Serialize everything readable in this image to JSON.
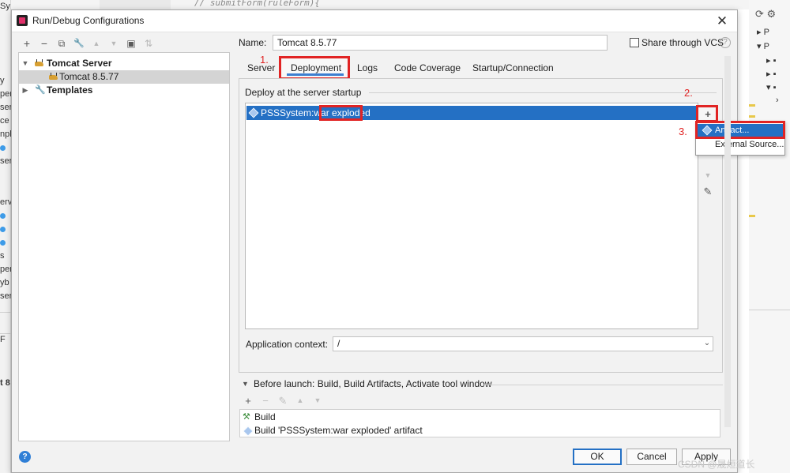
{
  "background": {
    "left_fragments": [
      "y",
      "per",
      "ser",
      "ce",
      "npl",
      "U",
      "ser",
      "ervl",
      "B",
      "S",
      "U",
      "s",
      "per",
      "yb",
      "ser",
      "F",
      "t 8"
    ],
    "editor_line": "//    submitForm(ruleForm){"
  },
  "dialog": {
    "title": "Run/Debug Configurations",
    "close_glyph": "✕"
  },
  "toolbar": {
    "add": "+",
    "remove": "−",
    "copy": "⧉",
    "edit": "🔧",
    "up": "▲",
    "down": "▼",
    "folder": "▣",
    "sort": "⇅"
  },
  "tree": {
    "items": [
      {
        "label": "Tomcat Server",
        "caret": "▼"
      },
      {
        "label": "Tomcat 8.5.77"
      },
      {
        "label": "Templates",
        "caret": "▶"
      }
    ]
  },
  "name_row": {
    "label": "Name:",
    "value": "Tomcat 8.5.77",
    "share_label": "Share through VCS",
    "help_glyph": "?"
  },
  "tabs": [
    "Server",
    "Deployment",
    "Logs",
    "Code Coverage",
    "Startup/Connection"
  ],
  "deployment": {
    "section_label": "Deploy at the server startup",
    "artifact_prefix": "PSSSystem:war",
    "artifact_suffix": " exploded",
    "add_glyph": "+",
    "edit_glyph": "✎",
    "down_glyph": "▼"
  },
  "annotations": [
    "1.",
    "2.",
    "3."
  ],
  "popup": {
    "items": [
      "Artifact...",
      "External Source..."
    ]
  },
  "context": {
    "label": "Application context:",
    "value": "/",
    "arrow": "⌄"
  },
  "before_launch": {
    "label": "Before launch: Build, Build Artifacts, Activate tool window",
    "tools": [
      "+",
      "−",
      "✎",
      "▲",
      "▼"
    ],
    "items": [
      "Build",
      "Build 'PSSSystem:war exploded' artifact"
    ]
  },
  "buttons": {
    "help": "?",
    "ok": "OK",
    "cancel": "Cancel",
    "apply": "Apply"
  },
  "watermark": "CSDN @晟烜道长"
}
